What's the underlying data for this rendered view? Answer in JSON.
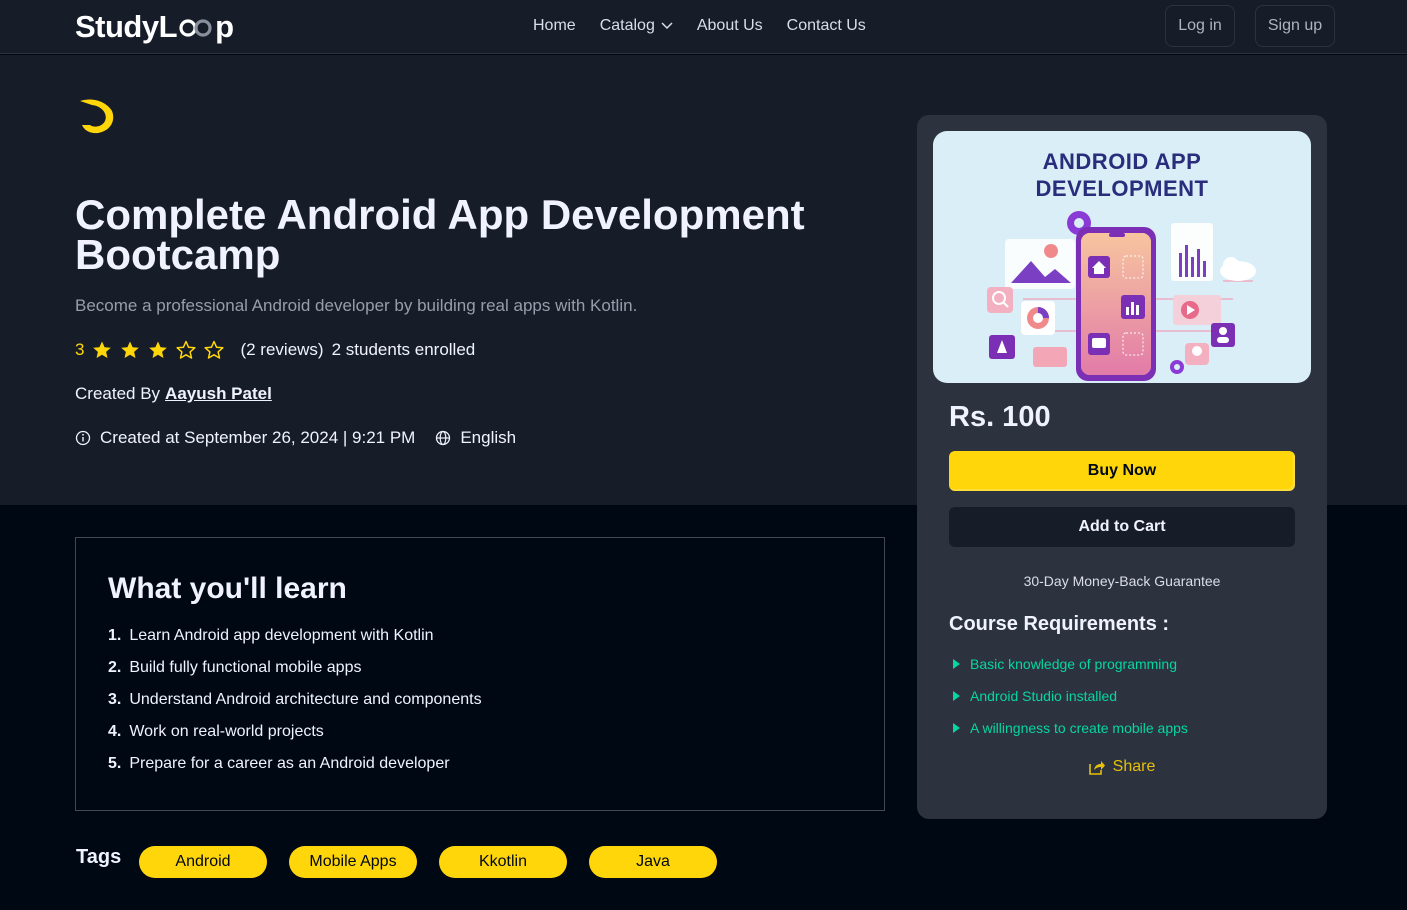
{
  "brand": {
    "prefix": "StudyL",
    "suffix": "p"
  },
  "nav": {
    "links": [
      "Home",
      "Catalog",
      "About Us",
      "Contact Us"
    ],
    "login": "Log in",
    "signup": "Sign up"
  },
  "course": {
    "title": "Complete Android App Development Bootcamp",
    "subtitle": "Become a professional Android developer by building real apps with Kotlin.",
    "rating": "3",
    "stars_filled": 3,
    "stars_total": 5,
    "reviews": "(2 reviews)",
    "enrolled": "2 students enrolled",
    "created_by_label": "Created By",
    "author": "Aayush Patel",
    "created_at": "Created at September 26, 2024 | 9:21 PM",
    "language": "English"
  },
  "card": {
    "thumbnail_title_line1": "ANDROID APP",
    "thumbnail_title_line2": "DEVELOPMENT",
    "price": "Rs. 100",
    "buy_label": "Buy Now",
    "cart_label": "Add to Cart",
    "guarantee": "30-Day Money-Back Guarantee",
    "requirements_title": "Course Requirements :",
    "requirements": [
      "Basic knowledge of programming",
      "Android Studio installed",
      "A willingness to create mobile apps"
    ],
    "share_label": "Share"
  },
  "learn": {
    "title": "What you'll learn",
    "items": [
      "Learn Android app development with Kotlin",
      "Build fully functional mobile apps",
      "Understand Android architecture and components",
      "Work on real-world projects",
      "Prepare for a career as an Android developer"
    ]
  },
  "tags": {
    "label": "Tags",
    "items": [
      "Android",
      "Mobile Apps",
      "Kkotlin",
      "Java"
    ]
  },
  "colors": {
    "accent_yellow": "#FFD60A",
    "requirement_green": "#06D6A0",
    "hero_bg": "#161D29",
    "page_bg": "#000814",
    "card_bg": "#2C333F"
  }
}
